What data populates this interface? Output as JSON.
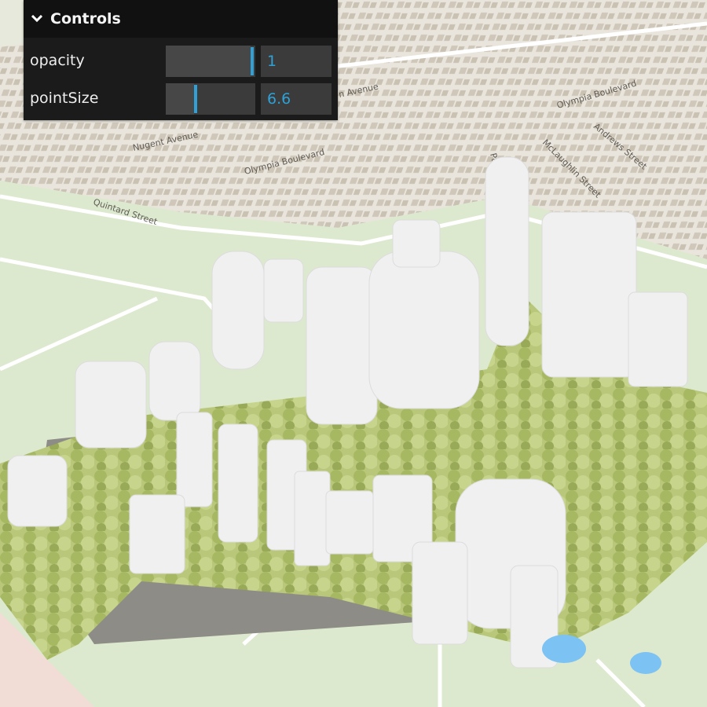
{
  "map": {
    "streets": [
      "Nugent Avenue",
      "Olympia Boulevard",
      "Quintard Street",
      "Olympia Boulevard",
      "Andrews Street",
      "McLaughlin Street",
      "Pa",
      "n Avenue",
      "et"
    ]
  },
  "controls": {
    "title": "Controls",
    "items": [
      {
        "label": "opacity",
        "value": "1",
        "fraction": 1.0
      },
      {
        "label": "pointSize",
        "value": "6.6",
        "fraction": 0.33
      }
    ]
  },
  "colors": {
    "accent": "#2fa1d6",
    "panel_bg": "#1b1b1b",
    "foliage": "#b3c46a",
    "buildings": "#f1f1f1",
    "water": "#7cc2f2",
    "park": "#dce9cf"
  }
}
